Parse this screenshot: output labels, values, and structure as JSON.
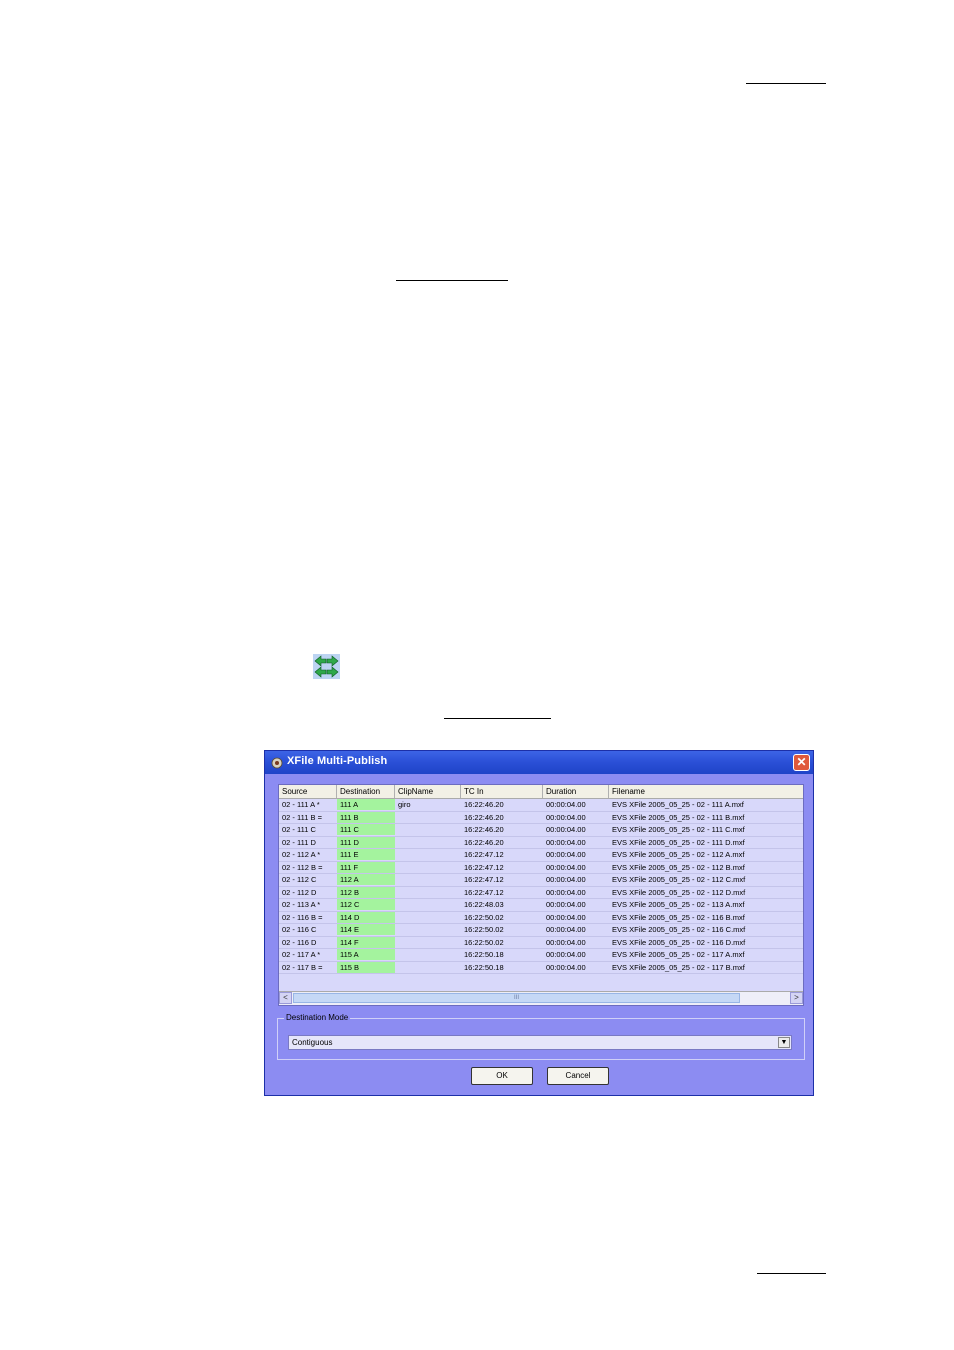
{
  "dialog": {
    "title": "XFile Multi-Publish",
    "close_label": "✕",
    "columns": [
      "Source",
      "Destination",
      "ClipName",
      "TC In",
      "Duration",
      "Filename"
    ],
    "rows": [
      [
        "02 - 111 A *",
        "111 A",
        "giro",
        "16:22:46.20",
        "00:00:04.00",
        "EVS XFile 2005_05_25 - 02 - 111 A.mxf"
      ],
      [
        "02 - 111 B =",
        "111 B",
        "",
        "16:22:46.20",
        "00:00:04.00",
        "EVS XFile 2005_05_25 - 02 - 111 B.mxf"
      ],
      [
        "02 - 111 C",
        "111 C",
        "",
        "16:22:46.20",
        "00:00:04.00",
        "EVS XFile 2005_05_25 - 02 - 111 C.mxf"
      ],
      [
        "02 - 111 D",
        "111 D",
        "",
        "16:22:46.20",
        "00:00:04.00",
        "EVS XFile 2005_05_25 - 02 - 111 D.mxf"
      ],
      [
        "02 - 112 A *",
        "111 E",
        "",
        "16:22:47.12",
        "00:00:04.00",
        "EVS XFile 2005_05_25 - 02 - 112 A.mxf"
      ],
      [
        "02 - 112 B =",
        "111 F",
        "",
        "16:22:47.12",
        "00:00:04.00",
        "EVS XFile 2005_05_25 - 02 - 112 B.mxf"
      ],
      [
        "02 - 112 C",
        "112 A",
        "",
        "16:22:47.12",
        "00:00:04.00",
        "EVS XFile 2005_05_25 - 02 - 112 C.mxf"
      ],
      [
        "02 - 112 D",
        "112 B",
        "",
        "16:22:47.12",
        "00:00:04.00",
        "EVS XFile 2005_05_25 - 02 - 112 D.mxf"
      ],
      [
        "02 - 113 A *",
        "112 C",
        "",
        "16:22:48.03",
        "00:00:04.00",
        "EVS XFile 2005_05_25 - 02 - 113 A.mxf"
      ],
      [
        "02 - 116 B =",
        "114 D",
        "",
        "16:22:50.02",
        "00:00:04.00",
        "EVS XFile 2005_05_25 - 02 - 116 B.mxf"
      ],
      [
        "02 - 116 C",
        "114 E",
        "",
        "16:22:50.02",
        "00:00:04.00",
        "EVS XFile 2005_05_25 - 02 - 116 C.mxf"
      ],
      [
        "02 - 116 D",
        "114 F",
        "",
        "16:22:50.02",
        "00:00:04.00",
        "EVS XFile 2005_05_25 - 02 - 116 D.mxf"
      ],
      [
        "02 - 117 A *",
        "115 A",
        "",
        "16:22:50.18",
        "00:00:04.00",
        "EVS XFile 2005_05_25 - 02 - 117 A.mxf"
      ],
      [
        "02 - 117 B =",
        "115 B",
        "",
        "16:22:50.18",
        "00:00:04.00",
        "EVS XFile 2005_05_25 - 02 - 117 B.mxf"
      ]
    ],
    "scroll_left": "<",
    "scroll_right": ">",
    "scroll_grip": "III",
    "destination_mode_label": "Destination Mode",
    "destination_mode_value": "Contiguous",
    "combo_arrow": "▼",
    "ok_label": "OK",
    "cancel_label": "Cancel"
  },
  "colors": {
    "dialog_bg": "#8c8cf2",
    "title_bar": "#2a4fd6",
    "destination_cell": "#a4f39e",
    "grid_bg": "#d8d8fa"
  }
}
